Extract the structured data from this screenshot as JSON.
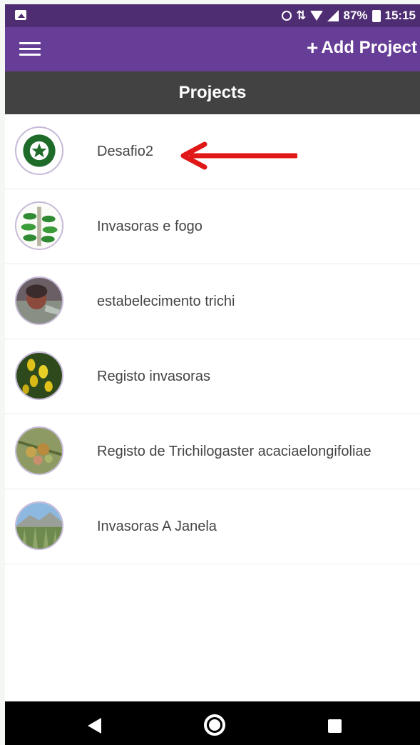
{
  "status_bar": {
    "battery_percent": "87%",
    "time": "15:15",
    "icons": [
      "image-icon",
      "alarm-icon",
      "data-icon",
      "wifi-icon",
      "signal-icon",
      "battery-icon"
    ]
  },
  "app_bar": {
    "menu_icon": "hamburger-icon",
    "add_label": "Add Project",
    "add_icon": "+"
  },
  "title_bar": {
    "title": "Projects"
  },
  "projects": [
    {
      "name": "Desafio2",
      "avatar": "flower-logo"
    },
    {
      "name": "Invasoras e fogo",
      "avatar": "plant-illustration"
    },
    {
      "name": "estabelecimento trichi",
      "avatar": "person-photo"
    },
    {
      "name": "Registo invasoras",
      "avatar": "yellow-flowers-photo"
    },
    {
      "name": "Registo de Trichilogaster acaciaelongifoliae",
      "avatar": "galls-photo"
    },
    {
      "name": "Invasoras A Janela",
      "avatar": "landscape-photo"
    }
  ],
  "colors": {
    "status_bar": "#4e2d73",
    "app_bar": "#663d97",
    "title_bar": "#424242",
    "annotation_arrow": "#e01818"
  },
  "nav_bar": {
    "icons": [
      "back-icon",
      "home-icon",
      "recents-icon"
    ]
  }
}
